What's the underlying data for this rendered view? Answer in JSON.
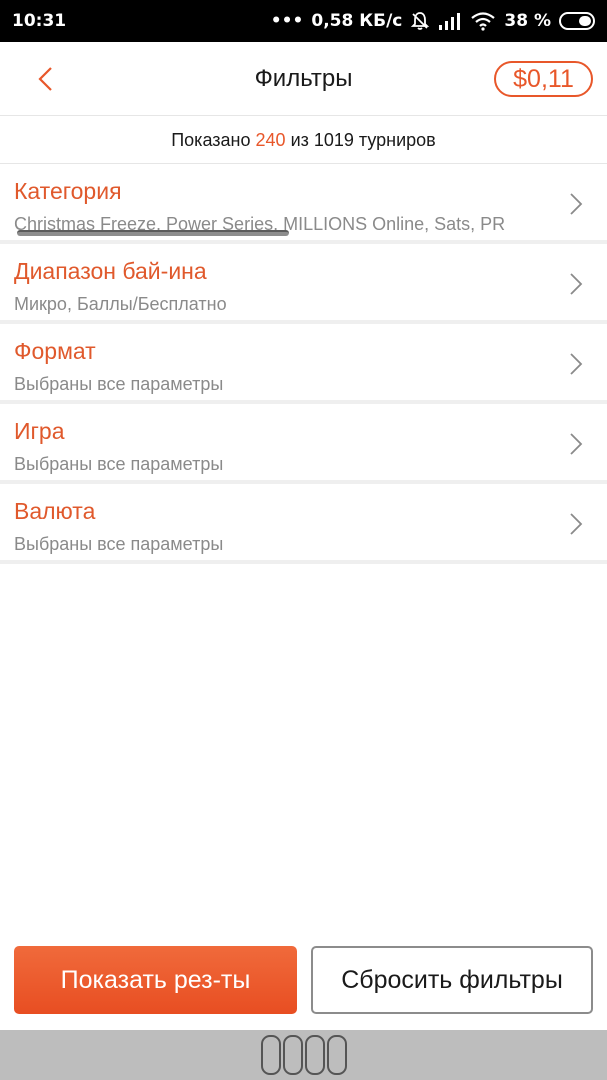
{
  "status_bar": {
    "time": "10:31",
    "network_speed": "0,58 КБ/с",
    "battery_percent": "38 %",
    "icons": [
      "dots-icon",
      "mute-bell-icon",
      "signal-icon",
      "wifi-icon",
      "battery-icon"
    ]
  },
  "header": {
    "title": "Фильтры",
    "balance": "$0,11",
    "back_icon": "chevron-left-icon"
  },
  "summary": {
    "prefix": "Показано",
    "shown": "240",
    "middle": "из 1019 турниров"
  },
  "filters": [
    {
      "title": "Категория",
      "value": "Christmas Freeze, Power Series, MILLIONS Online, Sats, PR"
    },
    {
      "title": "Диапазон бай-ина",
      "value": "Микро, Баллы/Бесплатно"
    },
    {
      "title": "Формат",
      "value": "Выбраны все параметры"
    },
    {
      "title": "Игра",
      "value": "Выбраны все параметры"
    },
    {
      "title": "Валюта",
      "value": "Выбраны все параметры"
    }
  ],
  "buttons": {
    "show_results": "Показать рез-ты",
    "reset_filters": "Сбросить фильтры"
  },
  "colors": {
    "accent": "#e8572a",
    "status_bar": "#000000",
    "nav_bar": "#bdbdbd"
  }
}
